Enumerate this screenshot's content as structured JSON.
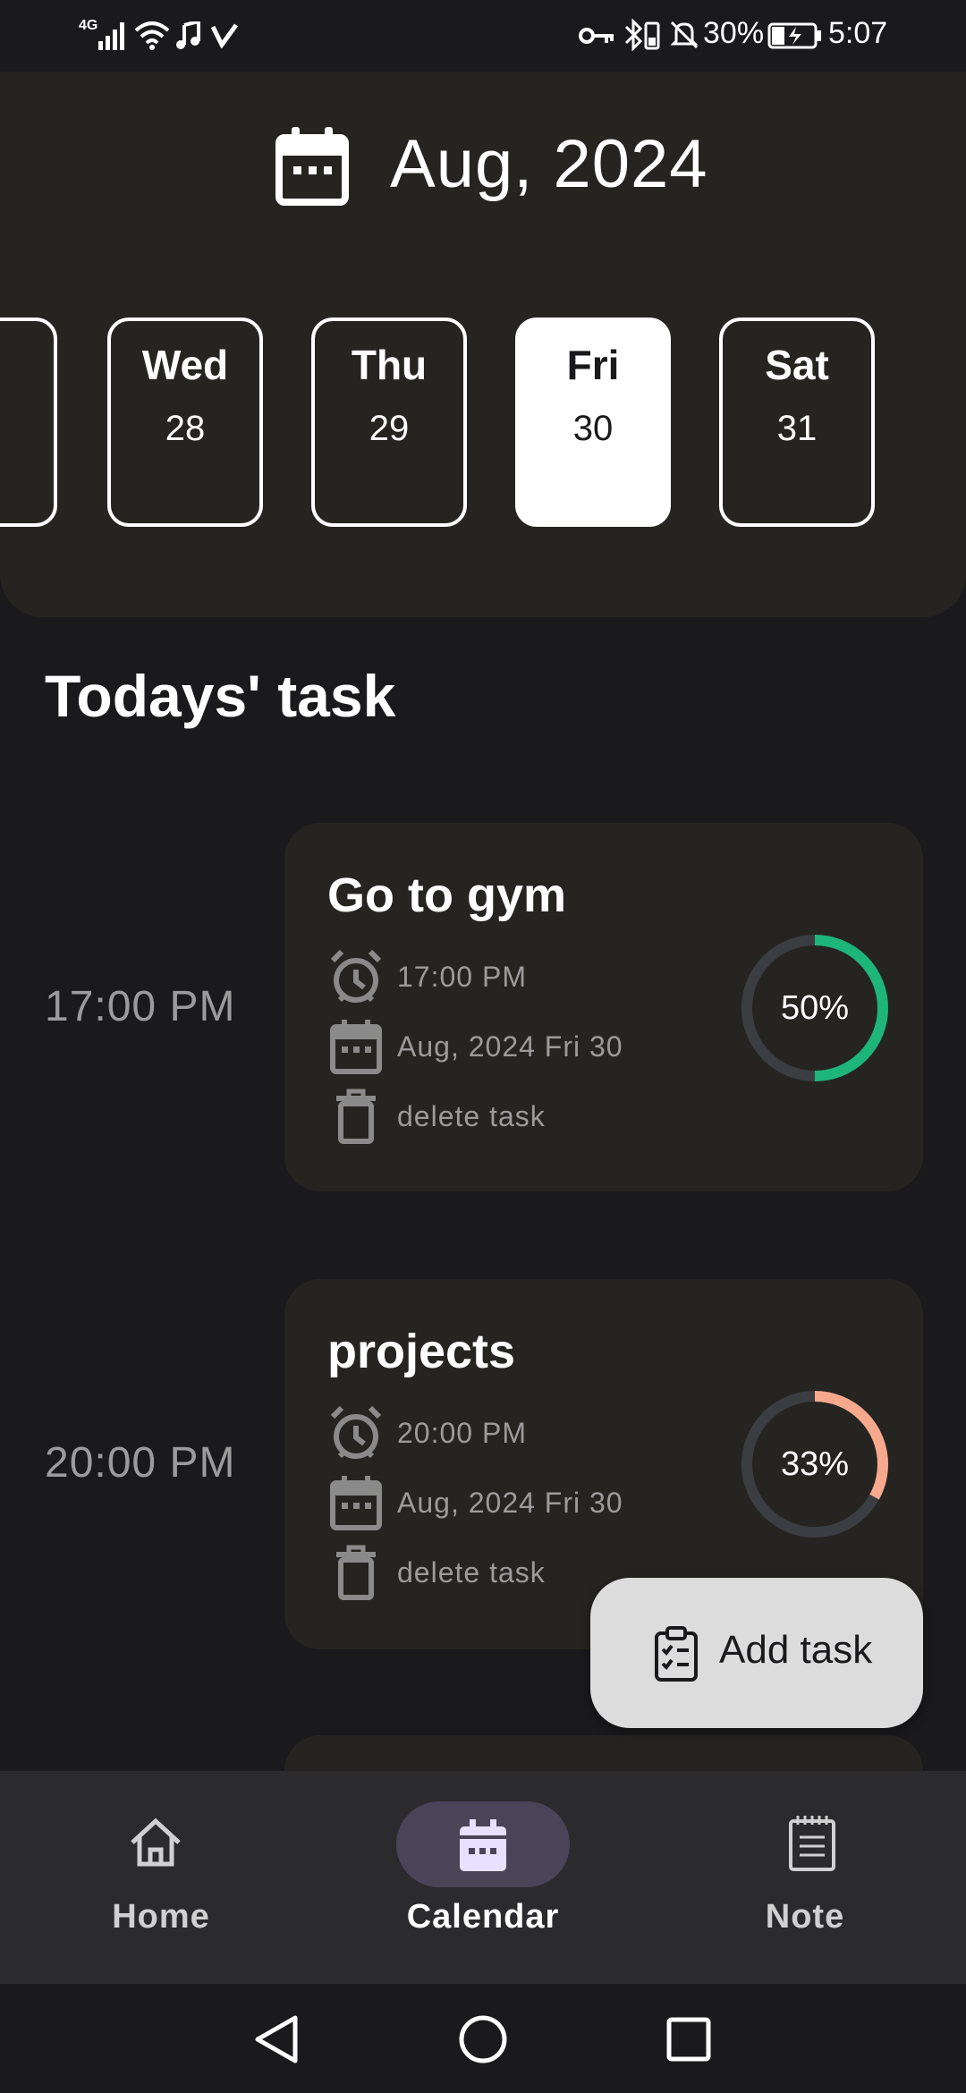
{
  "status_bar": {
    "network": "4G",
    "battery": "30%",
    "time": "5:07"
  },
  "header": {
    "month_title": "Aug, 2024",
    "days": [
      {
        "name": "Wed",
        "num": "28",
        "selected": false
      },
      {
        "name": "Thu",
        "num": "29",
        "selected": false
      },
      {
        "name": "Fri",
        "num": "30",
        "selected": true
      },
      {
        "name": "Sat",
        "num": "31",
        "selected": false
      }
    ]
  },
  "section_title": "Todays' task",
  "tasks": [
    {
      "time": "17:00 PM",
      "title": "Go to gym",
      "alarm": "17:00 PM",
      "date": "Aug, 2024 Fri 30",
      "delete_label": "delete task",
      "progress": 0.5,
      "progress_label": "50%",
      "ring_color": "#1db57a"
    },
    {
      "time": "20:00 PM",
      "title": "projects",
      "alarm": "20:00 PM",
      "date": "Aug, 2024 Fri 30",
      "delete_label": "delete task",
      "progress": 0.33,
      "progress_label": "33%",
      "ring_color": "#f6a98c"
    }
  ],
  "fab": {
    "label": "Add task",
    "icon": "clipboard-check-icon"
  },
  "bottom_nav": {
    "items": [
      {
        "label": "Home",
        "icon": "home-icon",
        "active": false
      },
      {
        "label": "Calendar",
        "icon": "calendar-icon",
        "active": true
      },
      {
        "label": "Note",
        "icon": "notepad-icon",
        "active": false
      }
    ]
  },
  "colors": {
    "background": "#1a1a1c",
    "card": "#252420",
    "accent_pill": "#4a4458",
    "ring_track": "#3a3d42"
  }
}
